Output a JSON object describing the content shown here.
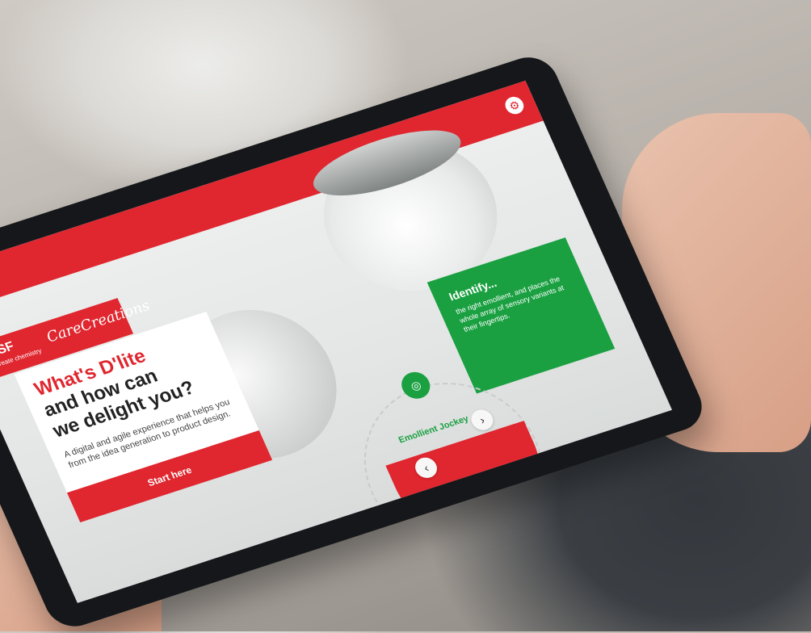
{
  "brand": {
    "name": "BASF",
    "tagline": "We create chemistry",
    "subbrand": "CareCreations"
  },
  "hero": {
    "title_line1": "What's D'lite",
    "title_line2": "and how can",
    "title_line3": "we delight you?",
    "description": "A digital and agile experience that helps you from the idea generation to product design.",
    "cta": "Start here"
  },
  "feature_card": {
    "heading": "Identify...",
    "body": "the right emollient, and places the whole array of sensory variants at their fingertips."
  },
  "selector": {
    "label": "Emollient Jockey",
    "prev_icon": "chevron-left-icon",
    "next_icon": "chevron-right-icon"
  },
  "colors": {
    "brand_red": "#e0262f",
    "accent_green": "#1aa041"
  }
}
